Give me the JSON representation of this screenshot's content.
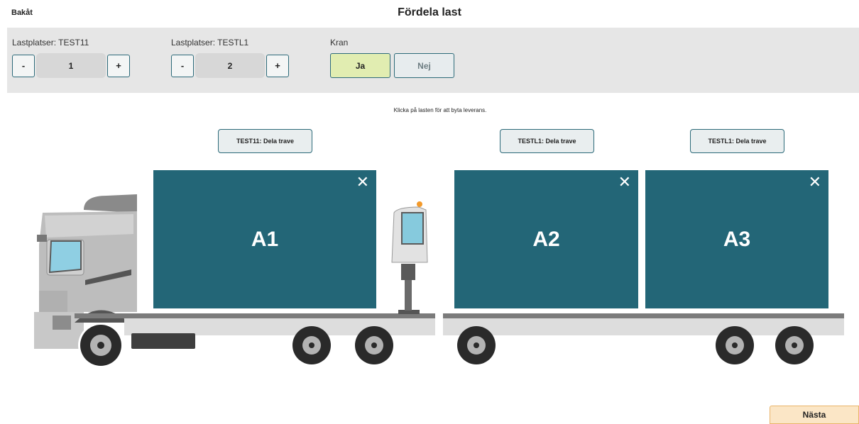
{
  "header": {
    "back_label": "Bakåt",
    "title": "Fördela last"
  },
  "controls": {
    "group1": {
      "label": "Lastplatser: TEST11",
      "minus": "-",
      "value": "1",
      "plus": "+"
    },
    "group2": {
      "label": "Lastplatser: TESTL1",
      "minus": "-",
      "value": "2",
      "plus": "+"
    },
    "crane": {
      "label": "Kran",
      "yes": "Ja",
      "no": "Nej",
      "selected": "Ja"
    }
  },
  "hint": "Klicka på lasten för att byta leverans.",
  "split_buttons": [
    "TEST11: Dela trave",
    "TESTL1: Dela trave",
    "TESTL1: Dela trave"
  ],
  "cargo": [
    {
      "label": "A1",
      "close": "✕"
    },
    {
      "label": "A2",
      "close": "✕"
    },
    {
      "label": "A3",
      "close": "✕"
    }
  ],
  "footer": {
    "next_label": "Nästa"
  },
  "colors": {
    "cargo": "#236677",
    "accent_border": "#2c6a79",
    "selected_toggle": "#e1edb1",
    "next_button": "#fbe6c6"
  }
}
